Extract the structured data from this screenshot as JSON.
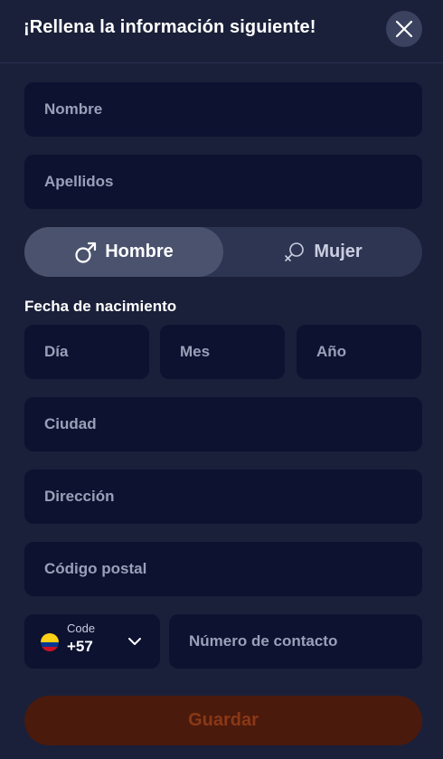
{
  "header": {
    "title": "¡Rellena la información siguiente!"
  },
  "form": {
    "first_name_placeholder": "Nombre",
    "last_name_placeholder": "Apellidos",
    "gender": {
      "male_label": "Hombre",
      "female_label": "Mujer",
      "selected": "Hombre"
    },
    "birth_date": {
      "label": "Fecha de nacimiento",
      "day_placeholder": "Día",
      "month_placeholder": "Mes",
      "year_placeholder": "Año"
    },
    "city_placeholder": "Ciudad",
    "address_placeholder": "Dirección",
    "postal_code_placeholder": "Código postal",
    "phone": {
      "code_label": "Code",
      "code_value": "+57",
      "flag_icon": "colombia-flag-icon",
      "number_placeholder": "Número de contacto"
    },
    "save_label": "Guardar"
  },
  "colors": {
    "background": "#1a2039",
    "field_bg": "#0c1230",
    "toggle_bg": "#2d3552",
    "toggle_active": "#4a526e",
    "save_bg": "#4a1a0c",
    "save_text": "#8a3816"
  }
}
